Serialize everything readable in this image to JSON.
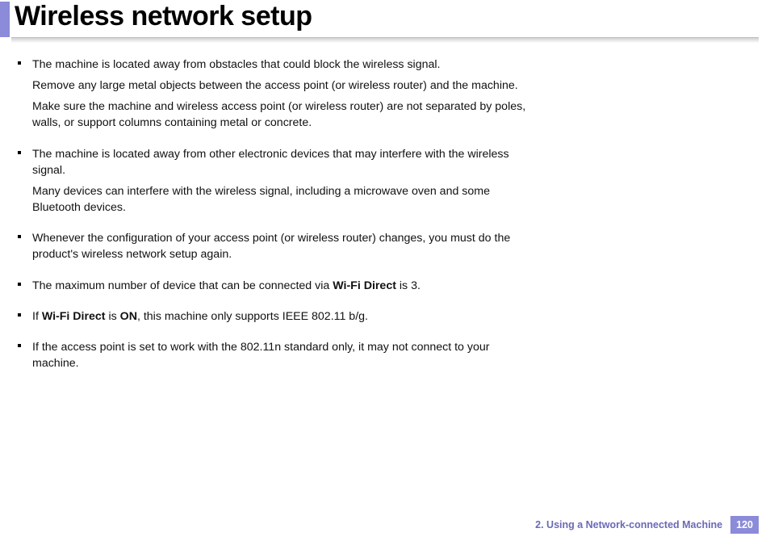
{
  "title": "Wireless network setup",
  "items": [
    {
      "paras": [
        [
          {
            "t": "The machine is located away from obstacles that could block the wireless signal.",
            "b": false
          }
        ],
        [
          {
            "t": "Remove any large metal objects between the access point (or wireless router) and the machine.",
            "b": false
          }
        ],
        [
          {
            "t": "Make sure the machine and wireless access point (or wireless router) are not separated by poles, walls, or support columns containing metal or concrete.",
            "b": false
          }
        ]
      ]
    },
    {
      "paras": [
        [
          {
            "t": "The machine is located away from other electronic devices that may interfere with the wireless signal.",
            "b": false
          }
        ],
        [
          {
            "t": "Many devices can interfere with the wireless signal, including a microwave oven and some Bluetooth devices.",
            "b": false
          }
        ]
      ]
    },
    {
      "paras": [
        [
          {
            "t": "Whenever the configuration of your access point (or wireless router) changes, you must do the product's wireless network setup again.",
            "b": false
          }
        ]
      ]
    },
    {
      "paras": [
        [
          {
            "t": "The maximum number of device that can be connected via ",
            "b": false
          },
          {
            "t": "Wi-Fi Direct",
            "b": true
          },
          {
            "t": " is 3.",
            "b": false
          }
        ]
      ]
    },
    {
      "paras": [
        [
          {
            "t": "If ",
            "b": false
          },
          {
            "t": "Wi-Fi Direct",
            "b": true
          },
          {
            "t": " is ",
            "b": false
          },
          {
            "t": "ON",
            "b": true
          },
          {
            "t": ", this machine only supports IEEE 802.11 b/g.",
            "b": false
          }
        ]
      ]
    },
    {
      "paras": [
        [
          {
            "t": "If the access point is set to work with the 802.11n standard only, it may not connect to your machine.",
            "b": false
          }
        ]
      ]
    }
  ],
  "footer": {
    "section": "2.  Using a Network-connected Machine",
    "page": "120"
  }
}
